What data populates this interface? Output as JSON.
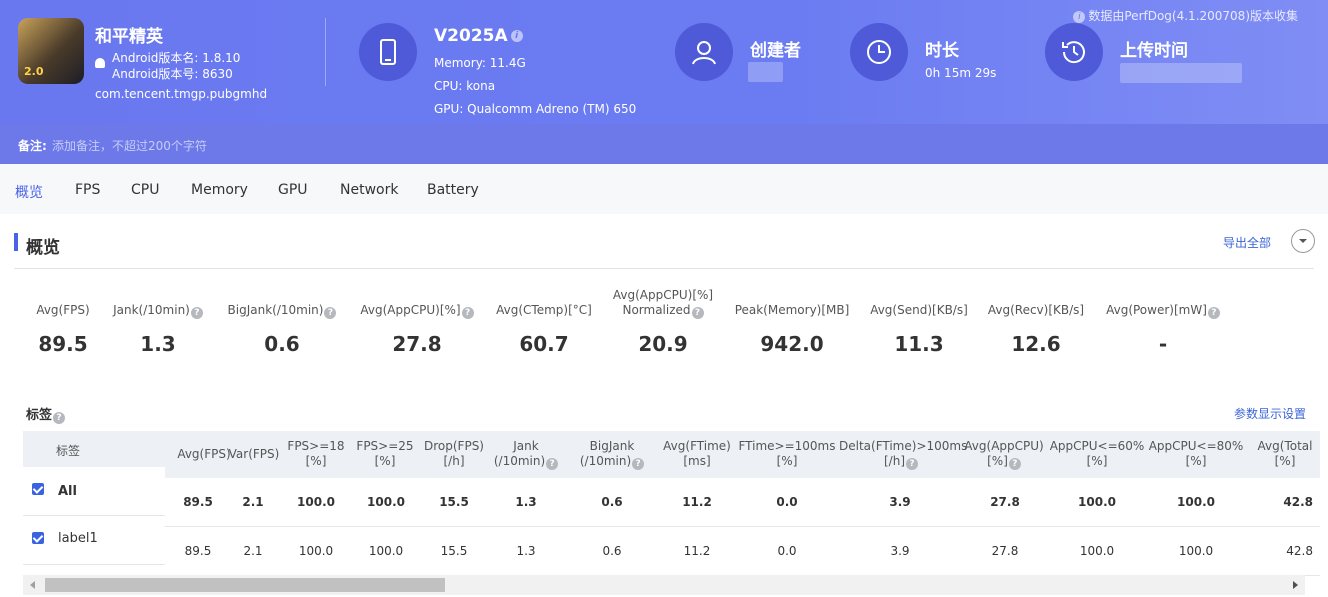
{
  "app": {
    "name": "和平精英",
    "version_name": "Android版本名: 1.8.10",
    "version_code": "Android版本号: 8630",
    "package": "com.tencent.tmgp.pubgmhd",
    "icon_badge": "2.0"
  },
  "device": {
    "model": "V2025A",
    "memory": "Memory: 11.4G",
    "cpu": "CPU: kona",
    "gpu": "GPU: Qualcomm Adreno (TM) 650"
  },
  "creator": {
    "title": "创建者"
  },
  "duration": {
    "title": "时长",
    "value": "0h 15m 29s"
  },
  "upload": {
    "title": "上传时间"
  },
  "source_note": "数据由PerfDog(4.1.200708)版本收集",
  "remark": {
    "label": "备注:",
    "placeholder": "添加备注，不超过200个字符"
  },
  "tabs": [
    "概览",
    "FPS",
    "CPU",
    "Memory",
    "GPU",
    "Network",
    "Battery"
  ],
  "overview": {
    "title": "概览",
    "export": "导出全部"
  },
  "stats": [
    {
      "label": "Avg(FPS)",
      "value": "89.5"
    },
    {
      "label": "Jank(/10min)",
      "value": "1.3"
    },
    {
      "label": "BigJank(/10min)",
      "value": "0.6"
    },
    {
      "label": "Avg(AppCPU)[%]",
      "value": "27.8"
    },
    {
      "label": "Avg(CTemp)[°C]",
      "value": "60.7"
    },
    {
      "label": "Avg(AppCPU)[%]",
      "label2": "Normalized",
      "value": "20.9"
    },
    {
      "label": "Peak(Memory)[MB]",
      "value": "942.0"
    },
    {
      "label": "Avg(Send)[KB/s]",
      "value": "11.3"
    },
    {
      "label": "Avg(Recv)[KB/s]",
      "value": "12.6"
    },
    {
      "label": "Avg(Power)[mW]",
      "value": "-"
    }
  ],
  "tags": {
    "title": "标签",
    "param_settings": "参数显示设置",
    "col_label": "标签",
    "headers": [
      {
        "l1": "Avg(FPS)",
        "l2": ""
      },
      {
        "l1": "Var(FPS)",
        "l2": ""
      },
      {
        "l1": "FPS>=18",
        "l2": "[%]"
      },
      {
        "l1": "FPS>=25",
        "l2": "[%]"
      },
      {
        "l1": "Drop(FPS)",
        "l2": "[/h]"
      },
      {
        "l1": "Jank",
        "l2": "(/10min)"
      },
      {
        "l1": "BigJank",
        "l2": "(/10min)"
      },
      {
        "l1": "Avg(FTime)",
        "l2": "[ms]"
      },
      {
        "l1": "FTime>=100ms",
        "l2": "[%]"
      },
      {
        "l1": "Delta(FTime)>100ms",
        "l2": "[/h]"
      },
      {
        "l1": "Avg(AppCPU)",
        "l2": "[%]"
      },
      {
        "l1": "AppCPU<=60%",
        "l2": "[%]"
      },
      {
        "l1": "AppCPU<=80%",
        "l2": "[%]"
      },
      {
        "l1": "Avg(Total",
        "l2": "[%]"
      }
    ],
    "rows": [
      {
        "name": "All",
        "values": [
          "89.5",
          "2.1",
          "100.0",
          "100.0",
          "15.5",
          "1.3",
          "0.6",
          "11.2",
          "0.0",
          "3.9",
          "27.8",
          "100.0",
          "100.0",
          "42.8"
        ]
      },
      {
        "name": "label1",
        "values": [
          "89.5",
          "2.1",
          "100.0",
          "100.0",
          "15.5",
          "1.3",
          "0.6",
          "11.2",
          "0.0",
          "3.9",
          "27.8",
          "100.0",
          "100.0",
          "42.8"
        ]
      }
    ]
  }
}
